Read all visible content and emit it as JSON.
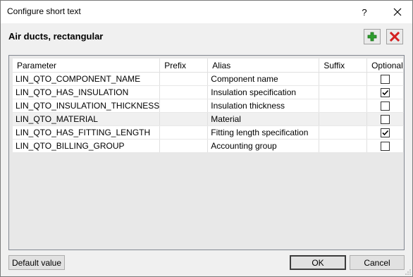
{
  "window": {
    "title": "Configure short text",
    "help_label": "?"
  },
  "header": {
    "title": "Air ducts, rectangular"
  },
  "table": {
    "columns": [
      "Parameter",
      "Prefix",
      "Alias",
      "Suffix",
      "Optional"
    ],
    "rows": [
      {
        "parameter": "LIN_QTO_COMPONENT_NAME",
        "prefix": "",
        "alias": "Component name",
        "suffix": "",
        "optional": false
      },
      {
        "parameter": "LIN_QTO_HAS_INSULATION",
        "prefix": "",
        "alias": "Insulation specification",
        "suffix": "",
        "optional": true
      },
      {
        "parameter": "LIN_QTO_INSULATION_THICKNESS",
        "prefix": "",
        "alias": "Insulation thickness",
        "suffix": "",
        "optional": false
      },
      {
        "parameter": "LIN_QTO_MATERIAL",
        "prefix": "",
        "alias": "Material",
        "suffix": "",
        "optional": false
      },
      {
        "parameter": "LIN_QTO_HAS_FITTING_LENGTH",
        "prefix": "",
        "alias": "Fitting length specification",
        "suffix": "",
        "optional": true
      },
      {
        "parameter": "LIN_QTO_BILLING_GROUP",
        "prefix": "",
        "alias": "Accounting group",
        "suffix": "",
        "optional": false
      }
    ]
  },
  "footer": {
    "default_value_label": "Default value",
    "ok_label": "OK",
    "cancel_label": "Cancel"
  },
  "colors": {
    "add_green": "#2e9e2e",
    "delete_red": "#d42020"
  }
}
